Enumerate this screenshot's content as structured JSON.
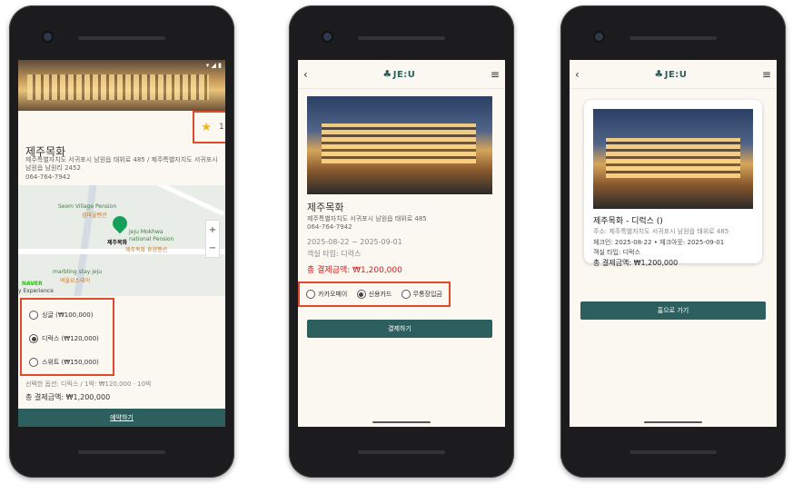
{
  "phone1": {
    "favorite_count": "1",
    "title": "제주목화",
    "address": "제주특별자치도 서귀포시 남원읍 태위로 485 / 제주특별자치도 서귀포시 남원읍 남원리 2452",
    "phone": "064-764-7942",
    "map": {
      "label_seom": "Seom Village Pension",
      "label_seom_kr": "섬마을펜션",
      "label_jeju": "Jeju Mokhwa",
      "label_jeju2": "national Pension",
      "pin_label": "제주목화",
      "label_mokhwa_kr": "제주목화 휴양펜션",
      "label_marbling": "marbling stay jeju",
      "label_marbling_kr": "여울요스테이",
      "naver": "NAVER",
      "naver2": "y Experience",
      "zoom_in": "+",
      "zoom_out": "−"
    },
    "rooms": [
      {
        "label": "싱글 (₩100,000)",
        "selected": false
      },
      {
        "label": "디럭스 (₩120,000)",
        "selected": true
      },
      {
        "label": "스위트 (₩150,000)",
        "selected": false
      }
    ],
    "selected_info": "선택한 옵션: 디럭스 / 1박: ₩120,000 · 10박",
    "total": "총 결제금액: ₩1,200,000",
    "reserve_label": "예약하기"
  },
  "phone2": {
    "logo": "JE:U",
    "title": "제주목화",
    "address": "제주특별자치도 서귀포시 남원읍 태위로 485",
    "phone": "064-764-7942",
    "dates": "2025-08-22 ~ 2025-09-01",
    "room_type": "객실 타입: 디럭스",
    "total": "총 결제금액: ₩1,200,000",
    "payments": [
      {
        "label": "카카오페이",
        "selected": false
      },
      {
        "label": "신용카드",
        "selected": true
      },
      {
        "label": "무통장입금",
        "selected": false
      }
    ],
    "pay_label": "결제하기"
  },
  "phone3": {
    "logo": "JE:U",
    "title": "제주목화 - 디럭스 ()",
    "address": "주소: 제주특별자치도 서귀포시 남원읍 태위로 485",
    "dates": "체크인: 2025-08-22  •  체크아웃: 2025-09-01",
    "room_type": "객실 타입: 디럭스",
    "total": "총 결제금액: ₩1,200,000",
    "home_label": "홈으로 가기"
  },
  "colors": {
    "accent": "#2c5f5d",
    "highlight": "#e04a2a",
    "price_red": "#d01e1e"
  }
}
